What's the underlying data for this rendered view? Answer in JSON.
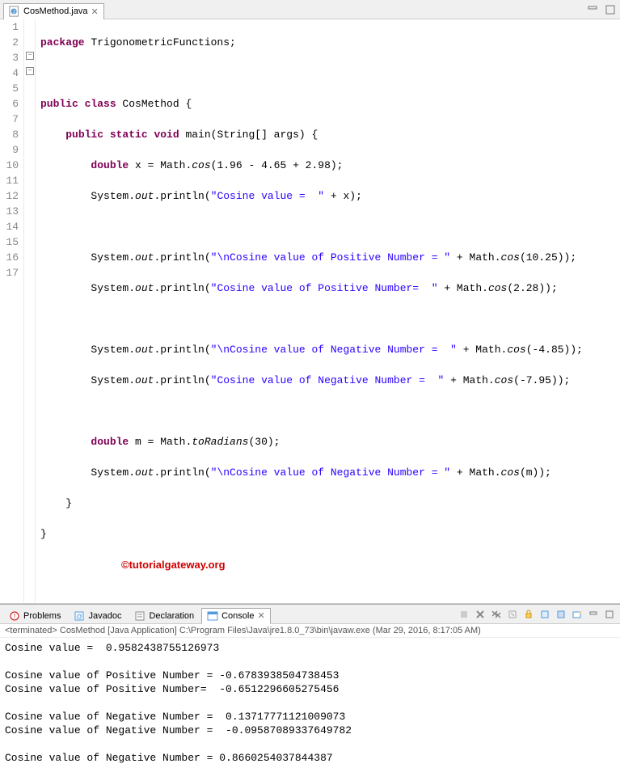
{
  "editor": {
    "tab_label": "CosMethod.java",
    "lines": [
      1,
      2,
      3,
      4,
      5,
      6,
      7,
      8,
      9,
      10,
      11,
      12,
      13,
      14,
      15,
      16,
      17
    ],
    "code": {
      "l1_pkg": "package",
      "l1_rest": " TrigonometricFunctions;",
      "l3_a": "public",
      "l3_b": " class",
      "l3_c": " CosMethod {",
      "l4_a": "public",
      "l4_b": " static",
      "l4_c": " void",
      "l4_d": " main(String[] args) {",
      "l5_a": "double",
      "l5_b": " x = Math.",
      "l5_c": "cos",
      "l5_d": "(1.96 - 4.65 + 2.98);",
      "l6_a": "System.",
      "l6_b": "out",
      "l6_c": ".println(",
      "l6_d": "\"Cosine value =  \"",
      "l6_e": " + x);",
      "l8_a": "System.",
      "l8_b": "out",
      "l8_c": ".println(",
      "l8_d": "\"\\nCosine value of Positive Number = \"",
      "l8_e": " + Math.",
      "l8_f": "cos",
      "l8_g": "(10.25));",
      "l9_a": "System.",
      "l9_b": "out",
      "l9_c": ".println(",
      "l9_d": "\"Cosine value of Positive Number=  \"",
      "l9_e": " + Math.",
      "l9_f": "cos",
      "l9_g": "(2.28));",
      "l11_a": "System.",
      "l11_b": "out",
      "l11_c": ".println(",
      "l11_d": "\"\\nCosine value of Negative Number =  \"",
      "l11_e": " + Math.",
      "l11_f": "cos",
      "l11_g": "(-4.85));",
      "l12_a": "System.",
      "l12_b": "out",
      "l12_c": ".println(",
      "l12_d": "\"Cosine value of Negative Number =  \"",
      "l12_e": " + Math.",
      "l12_f": "cos",
      "l12_g": "(-7.95));",
      "l14_a": "double",
      "l14_b": " m = Math.",
      "l14_c": "toRadians",
      "l14_d": "(30);",
      "l15_a": "System.",
      "l15_b": "out",
      "l15_c": ".println(",
      "l15_d": "\"\\nCosine value of Negative Number = \"",
      "l15_e": " + Math.",
      "l15_f": "cos",
      "l15_g": "(m));",
      "l16": "    }",
      "l17": "}"
    },
    "watermark": "©tutorialgateway.org"
  },
  "views": {
    "problems": "Problems",
    "javadoc": "Javadoc",
    "declaration": "Declaration",
    "console": "Console"
  },
  "console": {
    "header": "<terminated> CosMethod [Java Application] C:\\Program Files\\Java\\jre1.8.0_73\\bin\\javaw.exe (Mar 29, 2016, 8:17:05 AM)",
    "output": "Cosine value =  0.9582438755126973\n\nCosine value of Positive Number = -0.6783938504738453\nCosine value of Positive Number=  -0.6512296605275456\n\nCosine value of Negative Number =  0.13717771121009073\nCosine value of Negative Number =  -0.09587089337649782\n\nCosine value of Negative Number = 0.8660254037844387"
  }
}
